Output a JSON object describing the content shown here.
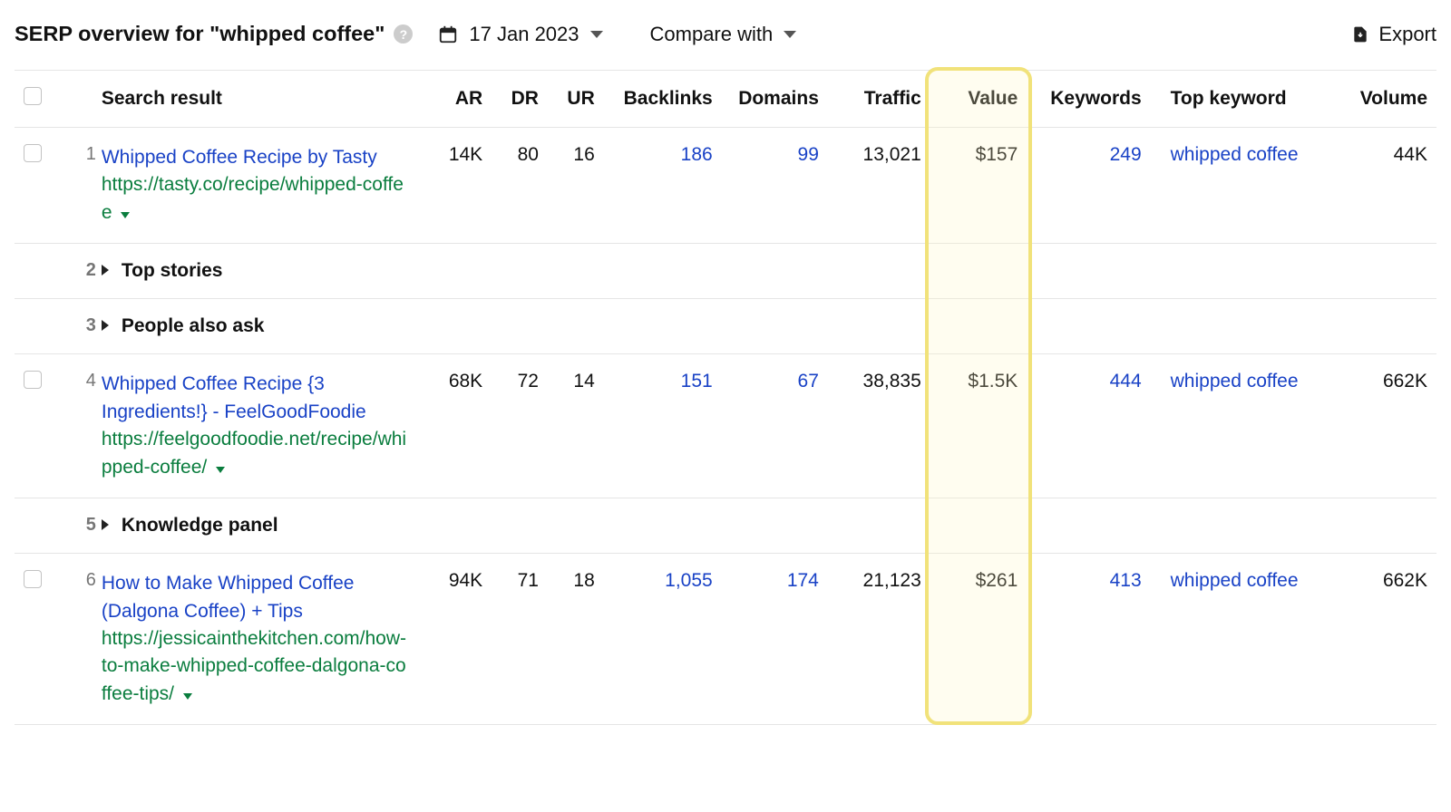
{
  "header": {
    "title": "SERP overview for \"whipped coffee\"",
    "date_label": "17 Jan 2023",
    "compare_label": "Compare with",
    "export_label": "Export"
  },
  "columns": {
    "search_result": "Search result",
    "ar": "AR",
    "dr": "DR",
    "ur": "UR",
    "backlinks": "Backlinks",
    "domains": "Domains",
    "traffic": "Traffic",
    "value": "Value",
    "keywords": "Keywords",
    "top_keyword": "Top keyword",
    "volume": "Volume"
  },
  "rows": [
    {
      "type": "result",
      "checkbox": true,
      "position": "1",
      "title": "Whipped Coffee Recipe by Tasty",
      "url": "https://tasty.co/recipe/whipped-coffee",
      "ar": "14K",
      "dr": "80",
      "ur": "16",
      "backlinks": "186",
      "domains": "99",
      "traffic": "13,021",
      "value": "$157",
      "keywords": "249",
      "top_keyword": "whipped coffee",
      "volume": "44K"
    },
    {
      "type": "feature",
      "checkbox": false,
      "position": "2",
      "label": "Top stories"
    },
    {
      "type": "feature",
      "checkbox": false,
      "position": "3",
      "label": "People also ask"
    },
    {
      "type": "result",
      "checkbox": true,
      "position": "4",
      "title": "Whipped Coffee Recipe {3 Ingredients!} - FeelGoodFoodie",
      "url": "https://feelgoodfoodie.net/recipe/whipped-coffee/",
      "ar": "68K",
      "dr": "72",
      "ur": "14",
      "backlinks": "151",
      "domains": "67",
      "traffic": "38,835",
      "value": "$1.5K",
      "keywords": "444",
      "top_keyword": "whipped coffee",
      "volume": "662K"
    },
    {
      "type": "feature",
      "checkbox": false,
      "position": "5",
      "label": "Knowledge panel"
    },
    {
      "type": "result",
      "checkbox": true,
      "position": "6",
      "title": "How to Make Whipped Coffee (Dalgona Coffee) + Tips",
      "url": "https://jessicainthekitchen.com/how-to-make-whipped-coffee-dalgona-coffee-tips/",
      "ar": "94K",
      "dr": "71",
      "ur": "18",
      "backlinks": "1,055",
      "domains": "174",
      "traffic": "21,123",
      "value": "$261",
      "keywords": "413",
      "top_keyword": "whipped coffee",
      "volume": "662K"
    }
  ]
}
